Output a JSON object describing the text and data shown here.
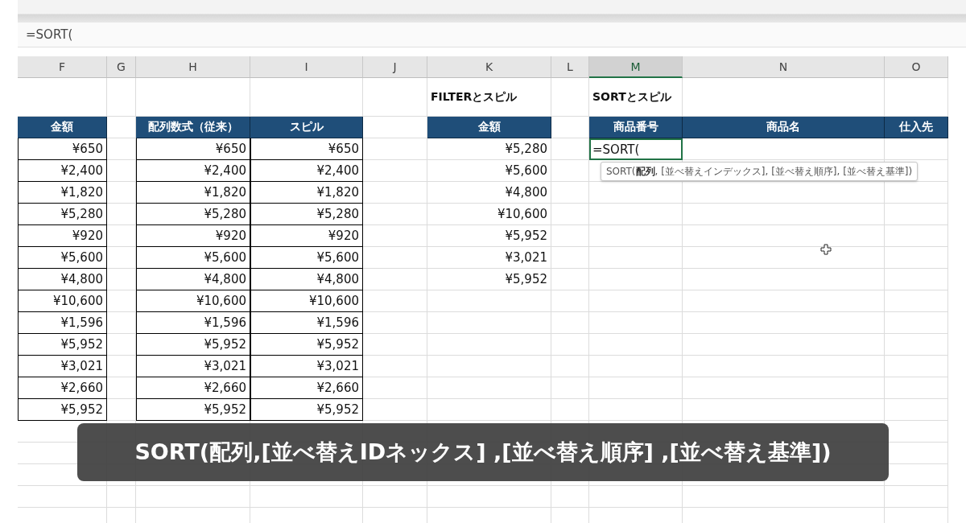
{
  "formula_bar": {
    "value": "=SORT("
  },
  "columns": [
    {
      "letter": "F",
      "bordered": true,
      "header": "金額",
      "values": [
        "¥650",
        "¥2,400",
        "¥1,820",
        "¥5,280",
        "¥920",
        "¥5,600",
        "¥4,800",
        "¥10,600",
        "¥1,596",
        "¥5,952",
        "¥3,021",
        "¥2,660",
        "¥5,952"
      ]
    },
    {
      "letter": "G"
    },
    {
      "letter": "H",
      "bordered": true,
      "header": "配列数式（従来）",
      "values": [
        "¥650",
        "¥2,400",
        "¥1,820",
        "¥5,280",
        "¥920",
        "¥5,600",
        "¥4,800",
        "¥10,600",
        "¥1,596",
        "¥5,952",
        "¥3,021",
        "¥2,660",
        "¥5,952"
      ]
    },
    {
      "letter": "I",
      "bordered": true,
      "header": "スピル",
      "values": [
        "¥650",
        "¥2,400",
        "¥1,820",
        "¥5,280",
        "¥920",
        "¥5,600",
        "¥4,800",
        "¥10,600",
        "¥1,596",
        "¥5,952",
        "¥3,021",
        "¥2,660",
        "¥5,952"
      ]
    },
    {
      "letter": "J"
    },
    {
      "letter": "K",
      "bordered": false,
      "title": "FILTERとスピル",
      "header": "金額",
      "values": [
        "¥5,280",
        "¥5,600",
        "¥4,800",
        "¥10,600",
        "¥5,952",
        "¥3,021",
        "¥5,952"
      ]
    },
    {
      "letter": "L"
    },
    {
      "letter": "M",
      "selected": true,
      "title": "SORTとスピル",
      "header": "商品番号",
      "editing_cell": "=SORT("
    },
    {
      "letter": "N",
      "header": "商品名"
    },
    {
      "letter": "O",
      "header": "仕入先"
    }
  ],
  "tooltip": "SORT(**配列**, [並べ替えインデックス], [並べ替え順序], [並べ替え基準])",
  "caption": "SORT(配列,[並べ替えIDネックス] ,[並べ替え順序] ,[並べ替え基準])"
}
